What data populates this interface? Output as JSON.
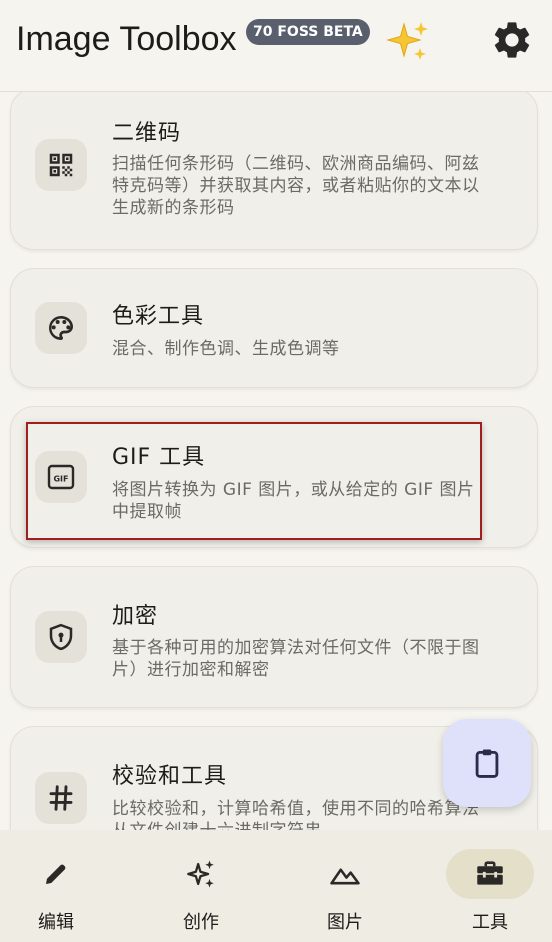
{
  "app": {
    "title": "Image Toolbox",
    "version_badge": "70 FOSS BETA",
    "sparkle_icon": "sparkles-icon",
    "settings_icon": "gear-icon"
  },
  "cards": [
    {
      "icon": "qr-code-icon",
      "title": "二维码",
      "description": "扫描任何条形码（二维码、欧洲商品编码、阿兹特克码等）并获取其内容，或者粘贴你的文本以生成新的条形码"
    },
    {
      "icon": "palette-icon",
      "title": "色彩工具",
      "description": "混合、制作色调、生成色调等"
    },
    {
      "icon": "gif-icon",
      "title": "GIF 工具",
      "description": "将图片转换为 GIF 图片，或从给定的 GIF 图片中提取帧",
      "highlighted": true
    },
    {
      "icon": "shield-lock-icon",
      "title": "加密",
      "description": "基于各种可用的加密算法对任何文件（不限于图片）进行加密和解密"
    },
    {
      "icon": "hashtag-icon",
      "title": "校验和工具",
      "description": "比较校验和，计算哈希值，使用不同的哈希算法从文件创建十六进制字符串"
    }
  ],
  "fab": {
    "icon": "clipboard-icon"
  },
  "bottom_nav": [
    {
      "label": "编辑",
      "icon": "pencil-icon",
      "active": false
    },
    {
      "label": "创作",
      "icon": "sparkles-icon",
      "active": false
    },
    {
      "label": "图片",
      "icon": "image-mountain-icon",
      "active": false
    },
    {
      "label": "工具",
      "icon": "toolbox-icon",
      "active": true
    }
  ],
  "colors": {
    "background": "#f6f4ef",
    "card": "#f1efe9",
    "highlight_border": "#a01e1e",
    "fab": "#dfe1fb",
    "active_nav_pill": "#e4dfc9",
    "badge": "#5a5f6e"
  }
}
